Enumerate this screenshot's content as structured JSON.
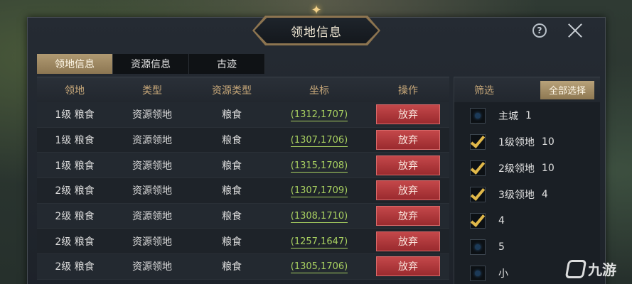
{
  "window": {
    "title": "领地信息",
    "help_label": "?"
  },
  "tabs": [
    {
      "label": "领地信息",
      "active": true
    },
    {
      "label": "资源信息",
      "active": false
    },
    {
      "label": "古迹",
      "active": false
    }
  ],
  "table": {
    "headers": [
      "领地",
      "类型",
      "资源类型",
      "坐标",
      "操作"
    ],
    "rows": [
      {
        "level": "1级  粮食",
        "type": "资源领地",
        "resource": "粮食",
        "coord": "(1312,1707)",
        "action": "放弃"
      },
      {
        "level": "1级  粮食",
        "type": "资源领地",
        "resource": "粮食",
        "coord": "(1307,1706)",
        "action": "放弃"
      },
      {
        "level": "1级  粮食",
        "type": "资源领地",
        "resource": "粮食",
        "coord": "(1315,1708)",
        "action": "放弃"
      },
      {
        "level": "2级  粮食",
        "type": "资源领地",
        "resource": "粮食",
        "coord": "(1307,1709)",
        "action": "放弃"
      },
      {
        "level": "2级  粮食",
        "type": "资源领地",
        "resource": "粮食",
        "coord": "(1308,1710)",
        "action": "放弃"
      },
      {
        "level": "2级  粮食",
        "type": "资源领地",
        "resource": "粮食",
        "coord": "(1257,1647)",
        "action": "放弃"
      },
      {
        "level": "2级  粮食",
        "type": "资源领地",
        "resource": "粮食",
        "coord": "(1305,1706)",
        "action": "放弃"
      }
    ]
  },
  "filter": {
    "label": "筛选",
    "select_all": "全部选择",
    "items": [
      {
        "label": "主城",
        "count": "1",
        "checked": false
      },
      {
        "label": "1级领地",
        "count": "10",
        "checked": true
      },
      {
        "label": "2级领地",
        "count": "10",
        "checked": true
      },
      {
        "label": "3级领地",
        "count": "4",
        "checked": true
      },
      {
        "label": "4",
        "count": "",
        "checked": true
      },
      {
        "label": "5",
        "count": "",
        "checked": false
      },
      {
        "label": "小",
        "count": "",
        "checked": false
      }
    ]
  },
  "watermark": {
    "text": "九游"
  },
  "colors": {
    "accent_gold": "#c9a97a",
    "coord_green": "#a8d060",
    "abandon_red": "#b03a3c",
    "check_gold": "#e0b84a"
  }
}
